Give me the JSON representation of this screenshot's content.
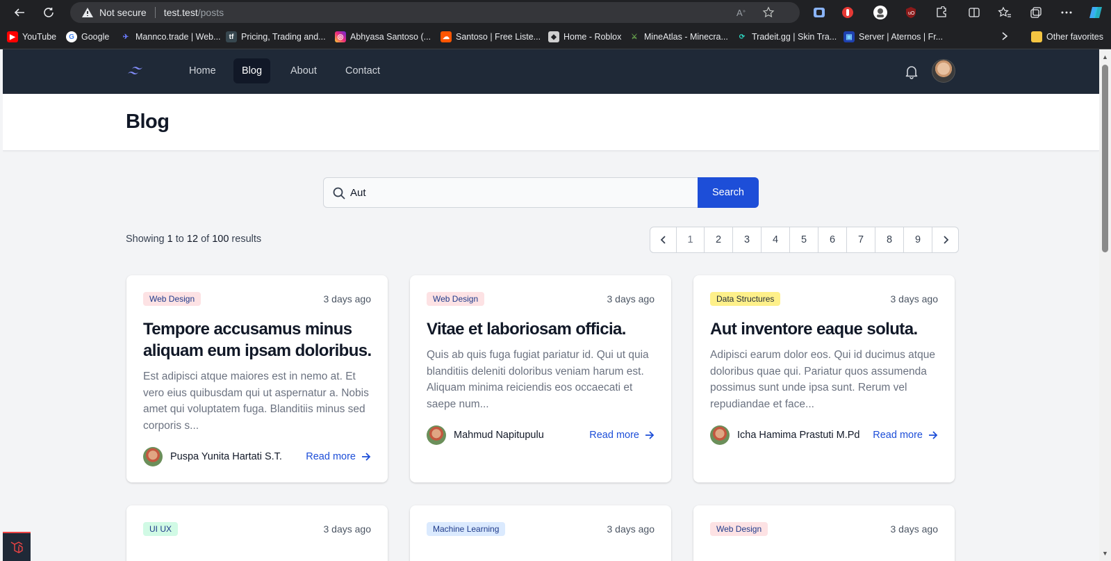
{
  "browser": {
    "security_label": "Not secure",
    "url_host": "test.test",
    "url_path": "/posts",
    "bookmarks": [
      {
        "label": "YouTube",
        "icon": "youtube-icon",
        "color": "#ff0000"
      },
      {
        "label": "Google",
        "icon": "google-icon",
        "color": "#4285f4"
      },
      {
        "label": "Mannco.trade | Web...",
        "icon": "mannco-icon",
        "color": "#6b7cff"
      },
      {
        "label": "Pricing, Trading and...",
        "icon": "tf-icon",
        "color": "#5a6b8c"
      },
      {
        "label": "Abhyasa Santoso (...",
        "icon": "instagram-icon",
        "color": "#d62976"
      },
      {
        "label": "Santoso | Free Liste...",
        "icon": "soundcloud-icon",
        "color": "#ff5500"
      },
      {
        "label": "Home - Roblox",
        "icon": "roblox-icon",
        "color": "#cfcfcf"
      },
      {
        "label": "MineAtlas - Minecra...",
        "icon": "mineatlas-icon",
        "color": "#4a7a3a"
      },
      {
        "label": "Tradeit.gg | Skin Tra...",
        "icon": "tradeit-icon",
        "color": "#2dd4bf"
      },
      {
        "label": "Server | Aternos | Fr...",
        "icon": "aternos-icon",
        "color": "#3b82f6"
      }
    ],
    "other_favorites": "Other favorites"
  },
  "nav": {
    "links": [
      {
        "label": "Home",
        "active": false
      },
      {
        "label": "Blog",
        "active": true
      },
      {
        "label": "About",
        "active": false
      },
      {
        "label": "Contact",
        "active": false
      }
    ]
  },
  "header": {
    "title": "Blog"
  },
  "search": {
    "value": "Aut",
    "button": "Search"
  },
  "results": {
    "prefix": "Showing",
    "from": "1",
    "to_word": "to",
    "to": "12",
    "of_word": "of",
    "total": "100",
    "suffix": "results"
  },
  "pagination": {
    "prev": "‹",
    "pages": [
      "1",
      "2",
      "3",
      "4",
      "5",
      "6",
      "7",
      "8",
      "9"
    ],
    "next": "›",
    "current": "1"
  },
  "posts": [
    {
      "category": "Web Design",
      "date": "3 days ago",
      "title": "Tempore accusamus minus aliquam eum ipsam doloribus.",
      "excerpt": "Est adipisci atque maiores est in nemo at. Et vero eius quibusdam qui ut aspernatur a. Nobis amet qui voluptatem fuga. Blanditiis minus sed corporis s...",
      "author": "Puspa Yunita Hartati S.T.",
      "read_more": "Read more"
    },
    {
      "category": "Web Design",
      "date": "3 days ago",
      "title": "Vitae et laboriosam officia.",
      "excerpt": "Quis ab quis fuga fugiat pariatur id. Qui ut quia blanditiis deleniti doloribus veniam harum est. Aliquam minima reiciendis eos occaecati et saepe num...",
      "author": "Mahmud Napitupulu",
      "read_more": "Read more"
    },
    {
      "category": "Data Structures",
      "date": "3 days ago",
      "title": "Aut inventore eaque soluta.",
      "excerpt": "Adipisci earum dolor eos. Qui id ducimus atque doloribus quae qui. Pariatur quos assumenda possimus sunt unde ipsa sunt. Rerum vel repudiandae et face...",
      "author": "Icha Hamima Prastuti M.Pd",
      "read_more": "Read more"
    },
    {
      "category": "UI UX",
      "date": "3 days ago"
    },
    {
      "category": "Machine Learning",
      "date": "3 days ago"
    },
    {
      "category": "Web Design",
      "date": "3 days ago"
    }
  ]
}
